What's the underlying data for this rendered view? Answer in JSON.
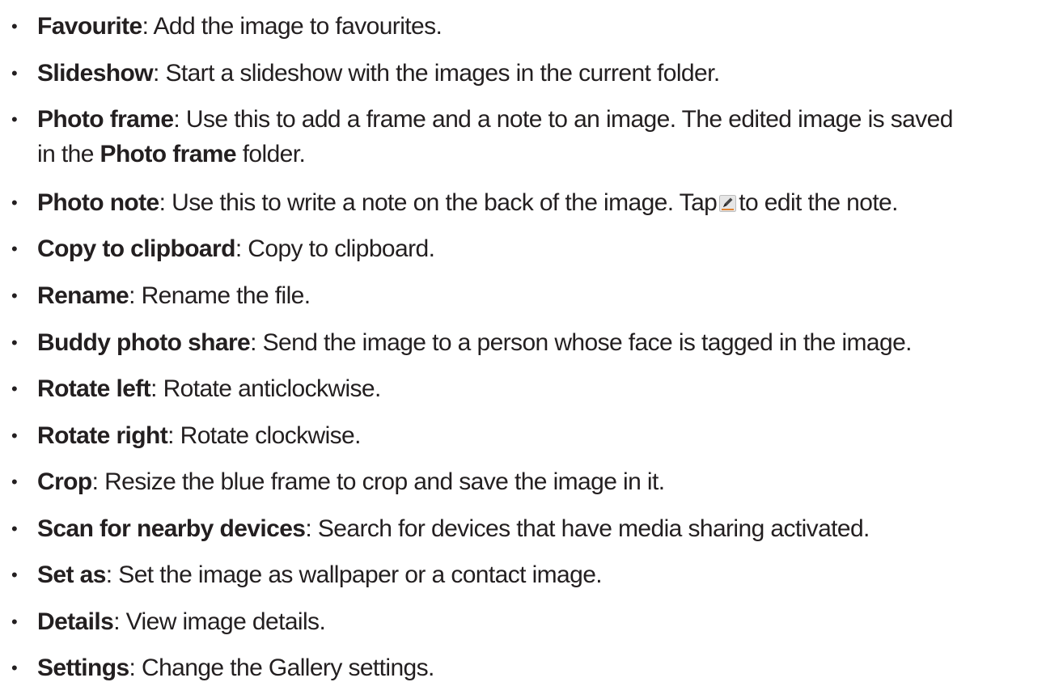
{
  "items": [
    {
      "term": "Favourite",
      "sep": ": ",
      "desc": "Add the image to favourites."
    },
    {
      "term": "Slideshow",
      "sep": ": ",
      "desc": "Start a slideshow with the images in the current folder."
    },
    {
      "term": "Photo frame",
      "sep": ": ",
      "desc": "Use this to add a frame and a note to an image. The edited image is saved",
      "desc2_pre": "in the ",
      "desc2_term": "Photo frame",
      "desc2_post": " folder."
    },
    {
      "term": "Photo note",
      "sep": ": ",
      "desc": "Use this to write a note on the back of the image. Tap",
      "icon": "edit-pencil-icon",
      "desc_after": "to edit the note."
    },
    {
      "term": "Copy to clipboard",
      "sep": ": ",
      "desc": "Copy to clipboard."
    },
    {
      "term": "Rename",
      "sep": ": ",
      "desc": "Rename the file."
    },
    {
      "term": "Buddy photo share",
      "sep": ": ",
      "desc": "Send the image to a person whose face is tagged in the image."
    },
    {
      "term": "Rotate left",
      "sep": ": ",
      "desc": "Rotate anticlockwise."
    },
    {
      "term": "Rotate right",
      "sep": ": ",
      "desc": "Rotate clockwise."
    },
    {
      "term": "Crop",
      "sep": ": ",
      "desc": "Resize the blue frame to crop and save the image in it."
    },
    {
      "term": "Scan for nearby devices",
      "sep": ": ",
      "desc": "Search for devices that have media sharing activated."
    },
    {
      "term": "Set as",
      "sep": ": ",
      "desc": "Set the image as wallpaper or a contact image."
    },
    {
      "term": "Details",
      "sep": ": ",
      "desc": "View image details."
    },
    {
      "term": "Settings",
      "sep": ": ",
      "desc": "Change the Gallery settings."
    }
  ],
  "bullet": "•"
}
